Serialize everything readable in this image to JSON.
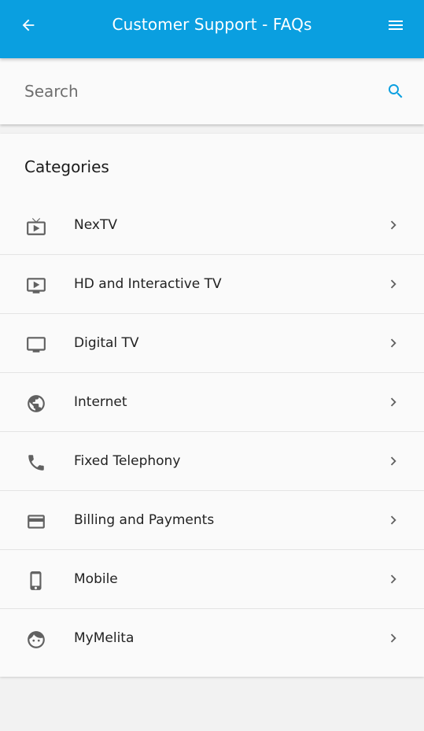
{
  "appbar": {
    "title": "Customer Support - FAQs",
    "back_icon": "arrow-left-icon",
    "menu_icon": "hamburger-menu-icon",
    "background": "#0a9fe0"
  },
  "search": {
    "placeholder": "Search",
    "value": "",
    "icon": "search-icon",
    "icon_color": "#0a9fe0"
  },
  "categories": {
    "heading": "Categories",
    "items": [
      {
        "label": "NexTV",
        "icon": "tv-antenna-icon"
      },
      {
        "label": "HD and Interactive TV",
        "icon": "play-screen-icon"
      },
      {
        "label": "Digital TV",
        "icon": "monitor-icon"
      },
      {
        "label": "Internet",
        "icon": "globe-icon"
      },
      {
        "label": "Fixed Telephony",
        "icon": "phone-icon"
      },
      {
        "label": "Billing and Payments",
        "icon": "credit-card-icon"
      },
      {
        "label": "Mobile",
        "icon": "smartphone-icon"
      },
      {
        "label": "MyMelita",
        "icon": "face-icon"
      }
    ]
  }
}
